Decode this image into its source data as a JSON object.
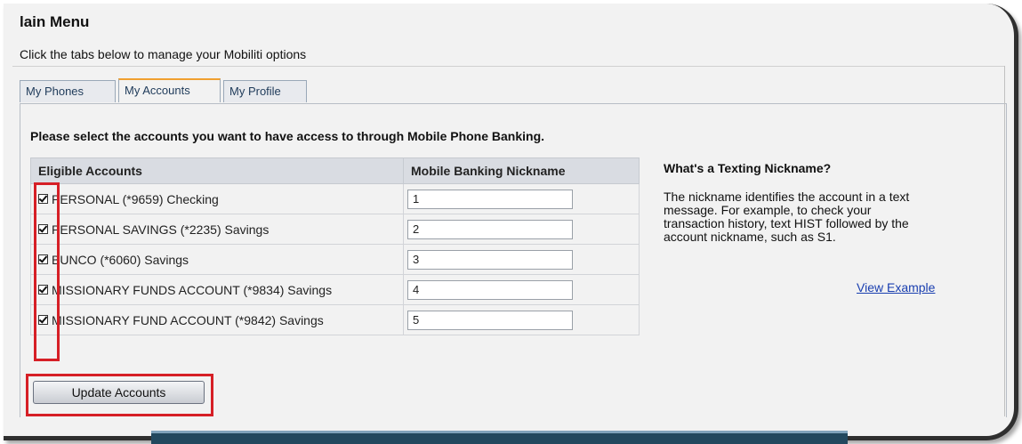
{
  "page": {
    "title": "lain Menu",
    "subtitle": "Click the tabs below to manage your Mobiliti options"
  },
  "tabs": [
    {
      "label": "My Phones",
      "active": false
    },
    {
      "label": "My Accounts",
      "active": true
    },
    {
      "label": "My Profile",
      "active": false
    }
  ],
  "instruction": "Please select the accounts you want to have access to through Mobile Phone Banking.",
  "table": {
    "headers": [
      "Eligible Accounts",
      "Mobile Banking Nickname"
    ],
    "rows": [
      {
        "checked": true,
        "account": "PERSONAL (*9659) Checking",
        "nickname": "1"
      },
      {
        "checked": true,
        "account": "PERSONAL SAVINGS (*2235) Savings",
        "nickname": "2"
      },
      {
        "checked": true,
        "account": "BUNCO (*6060) Savings",
        "nickname": "3"
      },
      {
        "checked": true,
        "account": "MISSIONARY FUNDS ACCOUNT (*9834) Savings",
        "nickname": "4"
      },
      {
        "checked": true,
        "account": "MISSIONARY FUND ACCOUNT (*9842) Savings",
        "nickname": "5"
      }
    ]
  },
  "sidebar": {
    "title": "What's a Texting Nickname?",
    "text": "The nickname identifies the account in a text message. For example, to check your transaction history, text HIST followed by the account nickname, such as S1.",
    "link": "View Example"
  },
  "actions": {
    "update_label": "Update Accounts"
  },
  "colors": {
    "highlight": "#d61f26",
    "link": "#1a3fb0",
    "active_tab_accent": "#f0a030",
    "bottom_bar": "#22485e"
  }
}
